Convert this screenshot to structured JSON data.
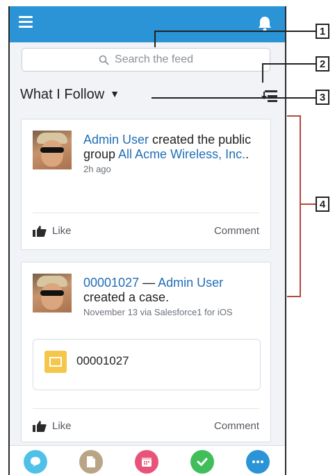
{
  "search": {
    "placeholder": "Search the feed"
  },
  "feed": {
    "filter_label": "What I Follow",
    "posts": [
      {
        "actor": "Admin User",
        "action": " created the public group ",
        "target": "All Acme Wireless, Inc.",
        "target_suffix": ".",
        "time": "2h ago",
        "like_label": "Like",
        "comment_label": "Comment"
      },
      {
        "record": "00001027",
        "separator": " — ",
        "actor": "Admin User",
        "action": "created a case.",
        "time": "November 13 via Salesforce1 for iOS",
        "attachment": "00001027",
        "like_label": "Like",
        "comment_label": "Comment"
      }
    ]
  },
  "tabbar": {
    "items": [
      {
        "icon": "chat-bubble-icon",
        "color": "#4fc1e9"
      },
      {
        "icon": "file-icon",
        "color": "#b9a586"
      },
      {
        "icon": "calendar-icon",
        "color": "#e8537a"
      },
      {
        "icon": "check-icon",
        "color": "#3fbe5a"
      },
      {
        "icon": "more-icon",
        "color": "#2a94d6"
      }
    ]
  },
  "callouts": [
    "1",
    "2",
    "3",
    "4"
  ],
  "colors": {
    "header": "#2a94d6",
    "link": "#1f6fb5",
    "callout_bracket": "#b5483c"
  }
}
